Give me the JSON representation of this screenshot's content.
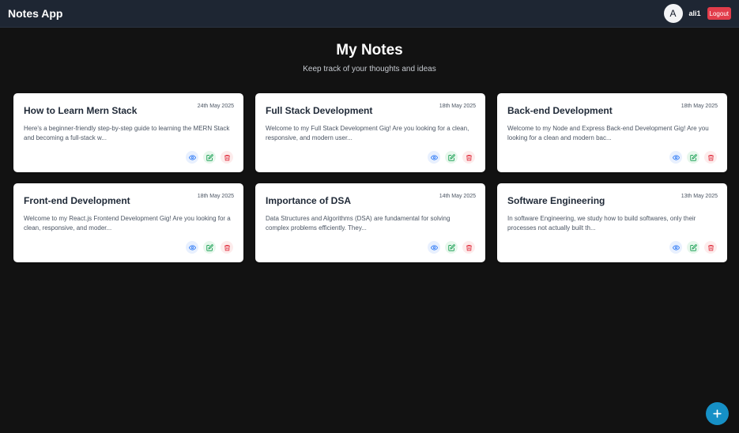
{
  "app": {
    "title": "Notes App"
  },
  "user": {
    "avatar_letter": "A",
    "name": "ali1",
    "logout_label": "Logout"
  },
  "page": {
    "title": "My Notes",
    "subtitle": "Keep track of your thoughts and ideas"
  },
  "notes": [
    {
      "title": "How to Learn Mern Stack",
      "date": "24th May 2025",
      "body": "Here's a beginner-friendly step-by-step guide to learning the MERN Stack and becoming a full-stack w..."
    },
    {
      "title": "Full Stack Development",
      "date": "18th May 2025",
      "body": "Welcome to my Full Stack Development Gig! Are you looking for a clean, responsive, and modern user..."
    },
    {
      "title": "Back-end Development",
      "date": "18th May 2025",
      "body": "Welcome to my Node and Express Back-end Development Gig! Are you looking for a clean and modern bac..."
    },
    {
      "title": "Front-end Development",
      "date": "18th May 2025",
      "body": "Welcome to my React.js Frontend Development Gig! Are you looking for a clean, responsive, and moder..."
    },
    {
      "title": "Importance of DSA",
      "date": "14th May 2025",
      "body": "Data Structures and Algorithms (DSA) are fundamental for solving complex problems efficiently. They..."
    },
    {
      "title": "Software Engineering",
      "date": "13th May 2025",
      "body": "In software Engineering, we study how to build softwares, only their processes not actually built th..."
    }
  ],
  "icons": {
    "view": "eye-icon",
    "edit": "edit-icon",
    "delete": "trash-icon",
    "add": "plus-icon"
  },
  "colors": {
    "view": "#3b82f6",
    "edit": "#22a35a",
    "delete": "#e23d4b",
    "fab": "#1690c6",
    "logout": "#e23d4b"
  }
}
